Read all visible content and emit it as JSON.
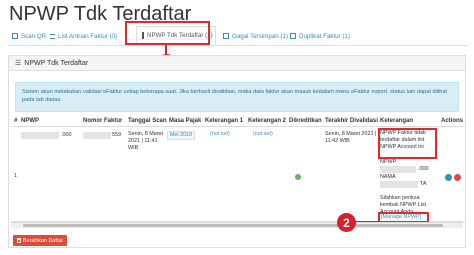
{
  "page": {
    "title": "NPWP Tdk Terdaftar"
  },
  "tabs": [
    {
      "label": "Scan QR",
      "icon": "qr-icon"
    },
    {
      "label": "List Antrian Faktur (0)",
      "icon": "list-icon"
    },
    {
      "label": "NPWP Tdk Terdaftar (1)",
      "icon": "file-icon",
      "active": true
    },
    {
      "label": "Gagal Tersimpan (1)",
      "icon": "warning-icon"
    },
    {
      "label": "Duplikat Faktur (1)",
      "icon": "copy-icon"
    }
  ],
  "callouts": {
    "one": "1",
    "two": "2"
  },
  "panel": {
    "heading": "NPWP Tdk Terdaftar",
    "alert": "Sistem akan melakukan validasi eFaktur setiap beberapa saat. Jika berhasil divalidasi, maka data faktur akan masuk kedalam menu eFaktur export. status lain dapat dilihat pada tab diatas."
  },
  "table": {
    "headers": {
      "num": "#",
      "npwp": "NPWP",
      "nomor": "Nomor Faktur",
      "tanggal": "Tanggal Scan",
      "masa": "Masa Pajak",
      "ket1": "Keterangan 1",
      "ket2": "Keterangan 2",
      "dikreditkan": "Dikreditkan",
      "terakhir": "Terakhir Divalidasi",
      "keterangan": "Keterangan",
      "actions": "Actions"
    },
    "row": {
      "num": "1",
      "npwp_suffix": ".000",
      "nomor_suffix": "559",
      "tanggal": "Senin, 8 Maret 2021 | 11:41 WIB",
      "masa": "Mei 2018",
      "ket1": "(not set)",
      "ket2": "(not set)",
      "terakhir": "Senin, 8 Maret 2021 | 11:42 WIB",
      "ket_highlight": "NPWP Faktur tidak terdaftar dalam list NPWP Account ini",
      "ket_npwp_label": "NPWP",
      "ket_npwp_suffix": ".000",
      "ket_nama_label": "NAMA",
      "ket_nama_suffix": "TA",
      "ket_note": "Silahkan periksa kembali NPWP List Account Anda",
      "manage_link": "[Manage NPWP]"
    }
  },
  "buttons": {
    "clear": "Bersihkan Daftar"
  },
  "colors": {
    "accent": "#3c8dbc",
    "highlight": "#dd2b2b",
    "danger": "#dd4b39",
    "info_bg": "#d9edf7"
  }
}
